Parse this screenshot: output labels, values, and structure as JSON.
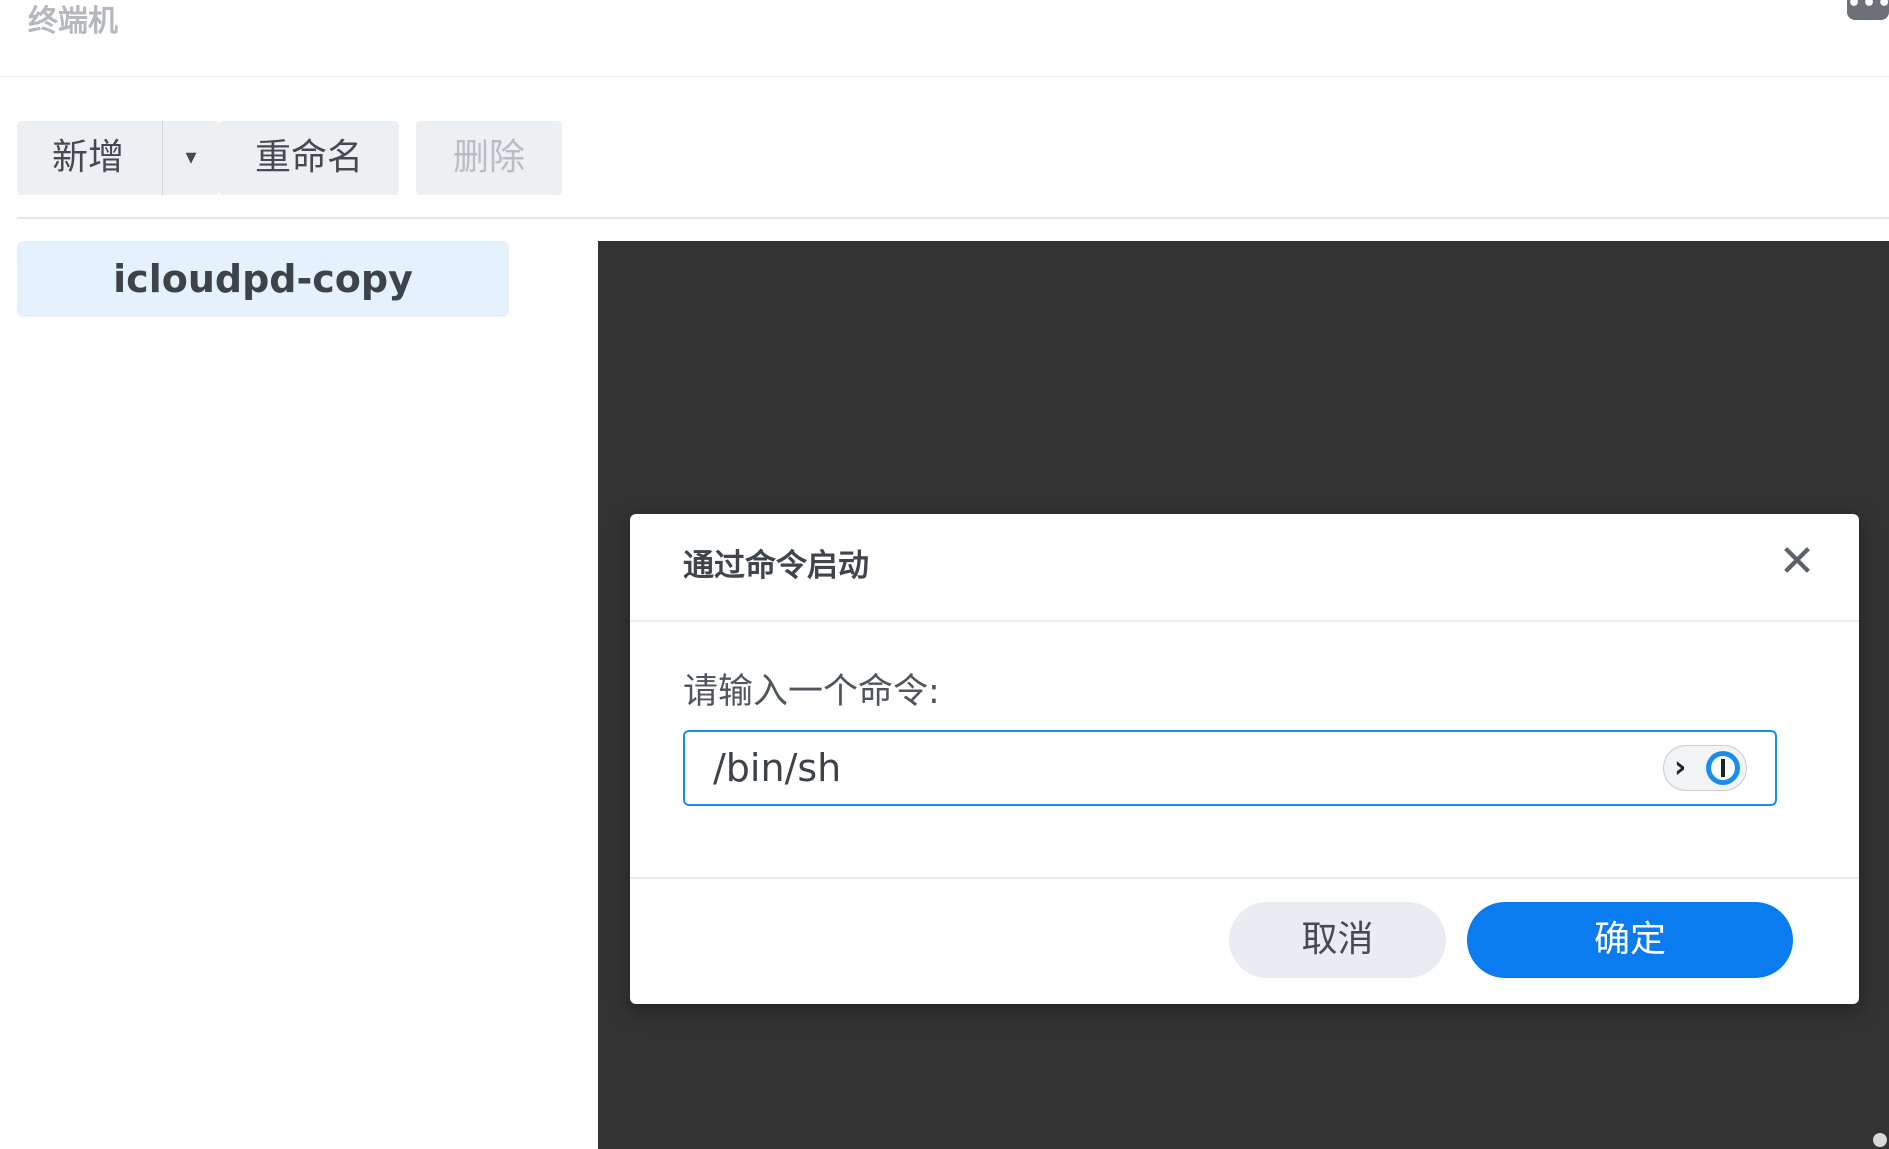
{
  "header": {
    "title": "终端机",
    "more_label": "•••"
  },
  "toolbar": {
    "new_label": "新增",
    "caret_icon": "caret-down-icon",
    "rename_label": "重命名",
    "delete_label": "删除"
  },
  "sidebar": {
    "items": [
      {
        "label": "icloudpd-copy",
        "selected": true
      }
    ]
  },
  "dialog": {
    "title": "通过命令启动",
    "close_icon": "close-icon",
    "field_label": "请输入一个命令:",
    "command_value": "/bin/sh",
    "cancel_label": "取消",
    "ok_label": "确定"
  },
  "colors": {
    "accent": "#0a7cf0",
    "terminal_bg": "#333333",
    "selected_item_bg": "#e5f1fd"
  }
}
